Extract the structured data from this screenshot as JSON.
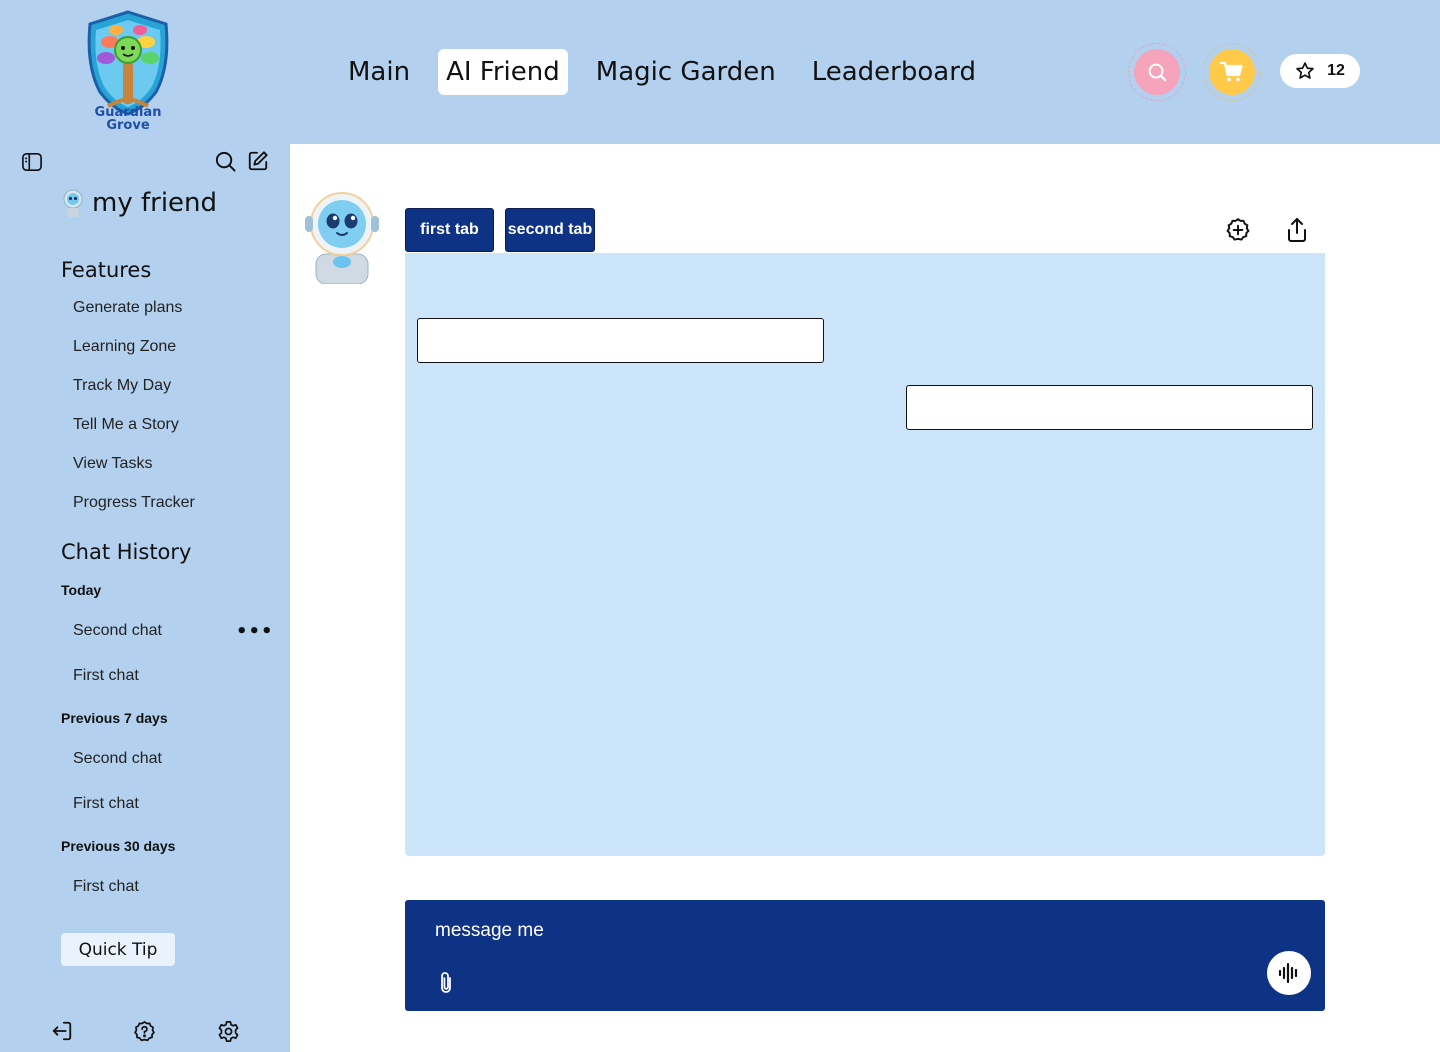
{
  "brand": {
    "line1": "Guardian",
    "line2": "Grove"
  },
  "nav": {
    "items": [
      {
        "label": "Main"
      },
      {
        "label": "AI Friend"
      },
      {
        "label": "Magic Garden"
      },
      {
        "label": "Leaderboard"
      }
    ],
    "active": "AI Friend"
  },
  "header": {
    "star_count": "12"
  },
  "sidebar": {
    "title": "my friend",
    "features_heading": "Features",
    "features": [
      "Generate plans",
      "Learning Zone",
      "Track My Day",
      "Tell Me a Story",
      "View Tasks",
      "Progress Tracker"
    ],
    "history_heading": "Chat History",
    "groups": [
      {
        "label": "Today",
        "chats": [
          "Second chat",
          "First chat"
        ]
      },
      {
        "label": "Previous 7 days",
        "chats": [
          "Second chat",
          "First chat"
        ]
      },
      {
        "label": "Previous 30 days",
        "chats": [
          "First chat"
        ]
      }
    ],
    "more_label": "•••",
    "quick_tip": "Quick Tip"
  },
  "chat": {
    "tabs": [
      {
        "label": "first tab"
      },
      {
        "label": "second tab"
      }
    ],
    "messages": [
      {
        "side": "left",
        "text": ""
      },
      {
        "side": "right",
        "text": ""
      }
    ],
    "composer_placeholder": "message me"
  },
  "colors": {
    "header_bg": "#b3d1ee",
    "accent_navy": "#0e3385",
    "chat_panel": "#cde5fb",
    "search_pink": "#f6a3bc",
    "cart_yellow": "#ffc94a"
  },
  "icons": [
    "sidebar-toggle-icon",
    "search-icon",
    "edit-icon",
    "new-chat-icon",
    "share-icon",
    "cart-icon",
    "star-icon",
    "paperclip-icon",
    "voice-icon",
    "logout-icon",
    "help-icon",
    "settings-icon"
  ]
}
